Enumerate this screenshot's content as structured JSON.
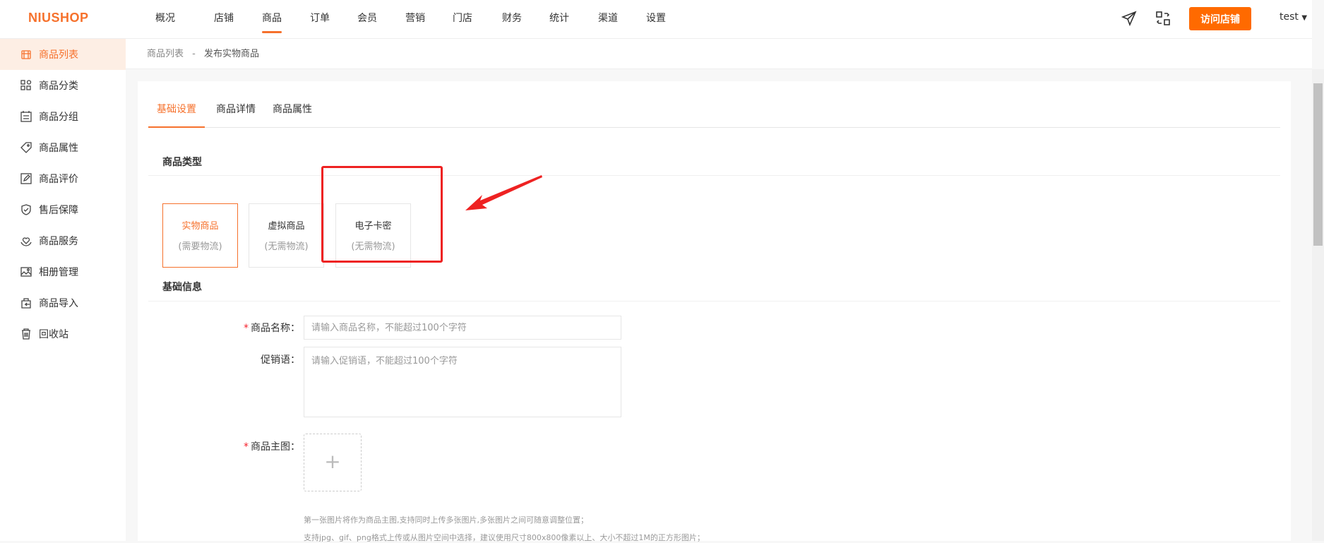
{
  "header": {
    "logo": "NIUSHOP",
    "nav": [
      "概况",
      "店铺",
      "商品",
      "订单",
      "会员",
      "营销",
      "门店",
      "财务",
      "统计",
      "渠道",
      "设置"
    ],
    "active_nav": 2,
    "visit_button": "访问店铺",
    "user": "test",
    "accent": "#f6712c"
  },
  "sidebar": {
    "items": [
      {
        "label": "商品列表",
        "icon": "goods-list-icon"
      },
      {
        "label": "商品分类",
        "icon": "category-icon"
      },
      {
        "label": "商品分组",
        "icon": "group-icon"
      },
      {
        "label": "商品属性",
        "icon": "tag-icon"
      },
      {
        "label": "商品评价",
        "icon": "edit-icon"
      },
      {
        "label": "售后保障",
        "icon": "shield-icon"
      },
      {
        "label": "商品服务",
        "icon": "heart-hand-icon"
      },
      {
        "label": "相册管理",
        "icon": "image-icon"
      },
      {
        "label": "商品导入",
        "icon": "import-icon"
      },
      {
        "label": "回收站",
        "icon": "trash-icon"
      }
    ]
  },
  "breadcrumb": {
    "parent": "商品列表",
    "sep": "-",
    "current": "发布实物商品"
  },
  "tabs": [
    "基础设置",
    "商品详情",
    "商品属性"
  ],
  "goods_type": {
    "title": "商品类型",
    "options": [
      {
        "name": "实物商品",
        "note": "(需要物流)"
      },
      {
        "name": "虚拟商品",
        "note": "(无需物流)"
      },
      {
        "name": "电子卡密",
        "note": "(无需物流)"
      }
    ]
  },
  "basic": {
    "title": "基础信息",
    "name_label": "商品名称：",
    "name_placeholder": "请输入商品名称，不能超过100个字符",
    "promo_label": "促销语：",
    "promo_placeholder": "请输入促销语，不能超过100个字符",
    "image_label": "商品主图：",
    "upload_plus": "+",
    "help1": "第一张图片将作为商品主图,支持同时上传多张图片,多张图片之间可随意调整位置；",
    "help2": "支持jpg、gif、png格式上传或从图片空间中选择，建议使用尺寸800x800像素以上、大小不超过1M的正方形图片；"
  }
}
